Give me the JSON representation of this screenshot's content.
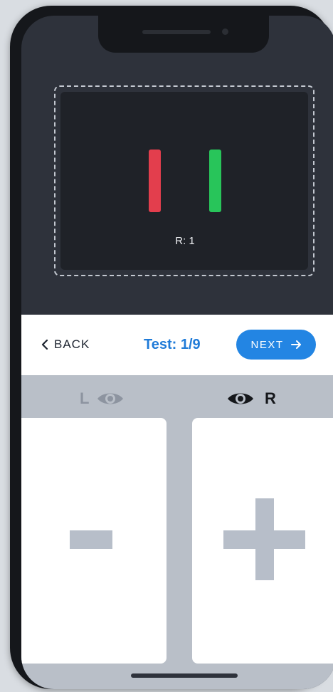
{
  "display": {
    "readout": "R: 1",
    "left_bar_color": "#e33e4d",
    "right_bar_color": "#28c55a"
  },
  "controls": {
    "back_label": "BACK",
    "test_label": "Test: 1/9",
    "next_label": "NEXT",
    "accent_color": "#2385e3"
  },
  "eyes": {
    "left_label": "L",
    "right_label": "R",
    "left_icon": "eye-icon",
    "right_icon": "eye-icon",
    "active": "R"
  },
  "adjust": {
    "minus_icon": "minus-icon",
    "plus_icon": "plus-icon"
  }
}
